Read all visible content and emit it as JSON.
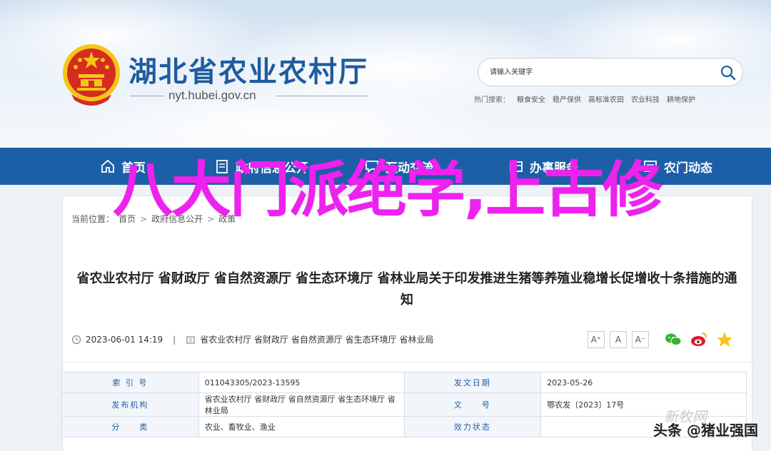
{
  "header": {
    "site_title": "湖北省农业农村厅",
    "site_domain": "nyt.hubei.gov.cn",
    "search_placeholder": "请输入关键字",
    "hot_search_label": "热门搜索：",
    "hot_search_items": [
      "粮食安全",
      "稳产保供",
      "高标准农田",
      "农业科技",
      "耕地保护"
    ]
  },
  "nav": {
    "items": [
      {
        "label": "首页",
        "icon": "home-icon"
      },
      {
        "label": "政府信息公开",
        "icon": "document-icon"
      },
      {
        "label": "互动交流",
        "icon": "chat-icon"
      },
      {
        "label": "办事服务",
        "icon": "service-icon"
      },
      {
        "label": "农门动态",
        "icon": "news-icon"
      }
    ]
  },
  "breadcrumb": {
    "prefix": "当前位置：",
    "items": [
      "首页",
      "政府信息公开",
      "政策"
    ],
    "separator": ">"
  },
  "article": {
    "title": "省农业农村厅 省财政厅 省自然资源厅 省生态环境厅 省林业局关于印发推进生猪等养殖业稳增长促增收十条措施的通知",
    "date": "2023-06-01 14:19",
    "separator": "|",
    "publishers": "省农业农村厅 省财政厅 省自然资源厅 省生态环境厅 省林业局"
  },
  "font_controls": {
    "large": "A⁺",
    "medium": "A",
    "small": "A⁻"
  },
  "info_table": {
    "rows": [
      {
        "l1": "索 引 号",
        "v1": "011043305/2023-13595",
        "l2": "发文日期",
        "v2": "2023-05-26"
      },
      {
        "l1": "发布机构",
        "v1": "省农业农村厅 省财政厅 省自然资源厅 省生态环境厅 省林业局",
        "l2": "文　　号",
        "v2": "鄂农发〔2023〕17号"
      },
      {
        "l1": "分　　类",
        "v1": "农业、畜牧业、渔业",
        "l2": "效力状态",
        "v2": ""
      }
    ]
  },
  "overlay": {
    "text": "八大门派绝学,上古修",
    "color": "#ee22ee"
  },
  "watermark": "新牧网",
  "source_tag": "头条 @猪业强国",
  "colors": {
    "nav_bg": "#1d5fa7",
    "title_blue": "#1f5b9f",
    "emblem_red": "#d62b20",
    "emblem_gold": "#f5c518"
  }
}
